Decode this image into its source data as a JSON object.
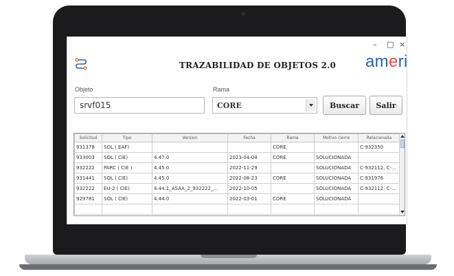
{
  "window": {
    "title": "TRAZABILIDAD DE OBJETOS 2.0",
    "brand": {
      "pre": "am",
      "dot": "e",
      "post": "rika"
    },
    "controls": {
      "minimize": "–",
      "maximize": "□",
      "close": "×"
    }
  },
  "form": {
    "objeto_label": "Objeto",
    "objeto_value": "srvf015",
    "rama_label": "Rama",
    "rama_value": "CORE",
    "buscar_label": "Buscar",
    "salir_label": "Salir"
  },
  "table": {
    "headers": [
      "Solicitud",
      "Tipo",
      "Version",
      "Fecha",
      "Rama",
      "Motivo cierre",
      "Relacionada"
    ],
    "rows": [
      [
        "931378",
        "SOL ( EAF)",
        "",
        "",
        "CORE",
        "",
        "C-932350"
      ],
      [
        "933003",
        "SOL ( CIE)",
        "4.47.0",
        "2023-04-04",
        "CORE",
        "SOLUCIONADA",
        ""
      ],
      [
        "932222",
        "PARC ( CIE )",
        "4.45.0",
        "2022-11-29",
        "",
        "SOLUCIONADA",
        "C-932112, C-..."
      ],
      [
        "931441",
        "SOL ( CIE)",
        "4.45.0",
        "2022-08-23",
        "CORE",
        "SOLUCIONADA",
        "C-931976"
      ],
      [
        "932222",
        "EU-2 ( CIE)",
        "4.44.1_ASAA_2_932222_...",
        "2022-10-05",
        "",
        "SOLUCIONADA",
        "C-932112, C-..."
      ],
      [
        "929781",
        "SOL ( CIE)",
        "4.44.0",
        "2022-03-01",
        "CORE",
        "SOLUCIONADA",
        ""
      ]
    ]
  },
  "colors": {
    "brand": "#2a63a8",
    "brand_accent": "#e64a3c",
    "bezel": "#1b1b1d"
  }
}
